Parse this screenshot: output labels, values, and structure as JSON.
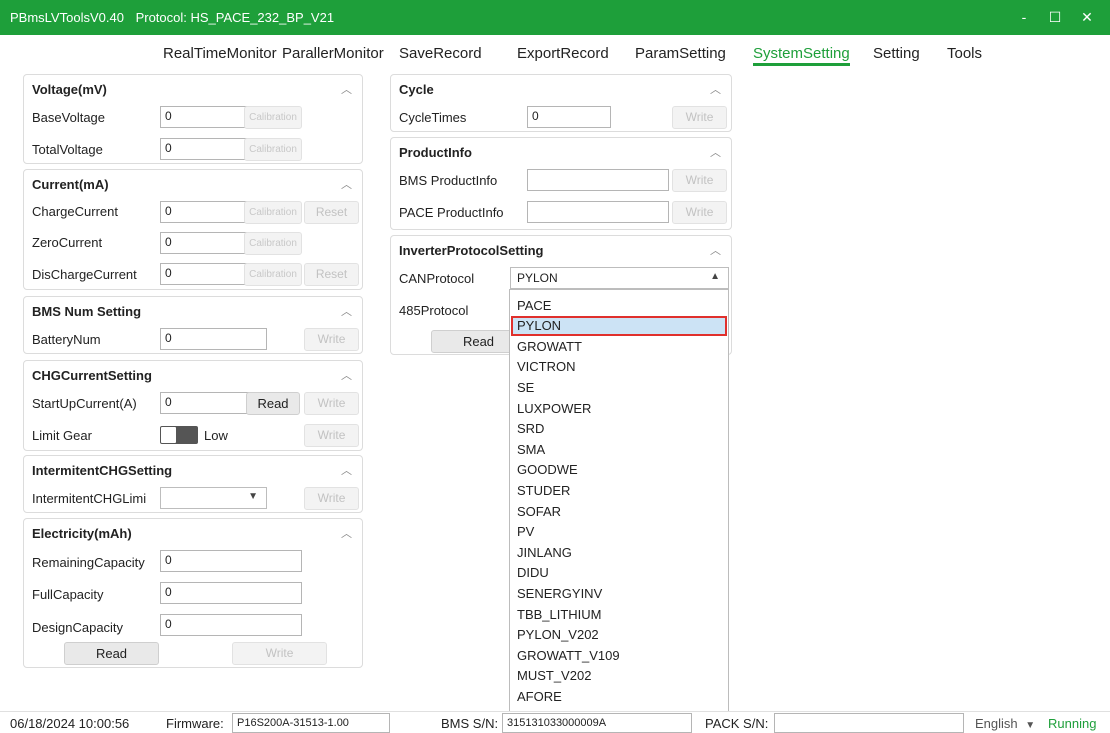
{
  "window": {
    "app_name": "PBmsLVToolsV0.40",
    "protocol": "Protocol: HS_PACE_232_BP_V21",
    "minimize": "-",
    "maximize": "☐",
    "close": "✕"
  },
  "nav": {
    "tabs": [
      "RealTimeMonitor",
      "ParallerMonitor",
      "SaveRecord",
      "ExportRecord",
      "ParamSetting",
      "SystemSetting",
      "Setting",
      "Tools"
    ],
    "active": "SystemSetting"
  },
  "voltage": {
    "title": "Voltage(mV)",
    "base_label": "BaseVoltage",
    "base_value": "0",
    "total_label": "TotalVoltage",
    "total_value": "0",
    "calibration": "Calibration"
  },
  "current": {
    "title": "Current(mA)",
    "charge_label": "ChargeCurrent",
    "charge_value": "0",
    "zero_label": "ZeroCurrent",
    "zero_value": "0",
    "discharge_label": "DisChargeCurrent",
    "discharge_value": "0",
    "calibration": "Calibration",
    "reset": "Reset"
  },
  "bms_num": {
    "title": "BMS Num Setting",
    "label": "BatteryNum",
    "value": "0",
    "write": "Write"
  },
  "chg_current": {
    "title": "CHGCurrentSetting",
    "startup_label": "StartUpCurrent(A)",
    "startup_value": "0",
    "read": "Read",
    "write": "Write",
    "limit_label": "Limit Gear",
    "limit_value": "Low"
  },
  "intermittent": {
    "title": "IntermitentCHGSetting",
    "label": "IntermitentCHGLimi",
    "value": "",
    "write": "Write"
  },
  "electricity": {
    "title": "Electricity(mAh)",
    "remaining_label": "RemainingCapacity",
    "remaining_value": "0",
    "full_label": "FullCapacity",
    "full_value": "0",
    "design_label": "DesignCapacity",
    "design_value": "0",
    "read": "Read",
    "write": "Write"
  },
  "cycle": {
    "title": "Cycle",
    "label": "CycleTimes",
    "value": "0",
    "write": "Write"
  },
  "product": {
    "title": "ProductInfo",
    "bms_label": "BMS ProductInfo",
    "bms_value": "",
    "pace_label": "PACE ProductInfo",
    "pace_value": "",
    "write": "Write"
  },
  "inverter": {
    "title": "InverterProtocolSetting",
    "can_label": "CANProtocol",
    "can_value": "PYLON",
    "rs485_label": "485Protocol",
    "read": "Read"
  },
  "dropdown": {
    "options": [
      "PACE",
      "PYLON",
      "GROWATT",
      "VICTRON",
      "SE",
      "LUXPOWER",
      "SRD",
      "SMA",
      "GOODWE",
      "STUDER",
      "SOFAR",
      "PV",
      "JINLANG",
      "DIDU",
      "SENERGYINV",
      "TBB_LITHIUM",
      "PYLON_V202",
      "GROWATT_V109",
      "MUST_V202",
      "AFORE"
    ],
    "selected_index": 1
  },
  "status": {
    "datetime": "06/18/2024 10:00:56",
    "firmware_label": "Firmware:",
    "firmware_value": "P16S200A-31513-1.00",
    "bms_sn_label": "BMS S/N:",
    "bms_sn_value": "315131033000009A",
    "pack_sn_label": "PACK S/N:",
    "pack_sn_value": "",
    "language": "English",
    "language_arrow": "▼",
    "state": "Running",
    "state_color": "#1e9f3a"
  },
  "colors": {
    "accent": "#1e9f3a",
    "selection": "#cce3f5",
    "highlight_border": "#e0302c"
  }
}
